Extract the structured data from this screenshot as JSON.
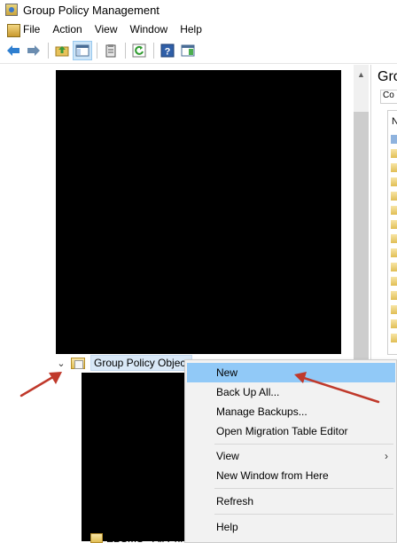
{
  "window": {
    "title": "Group Policy Management"
  },
  "menu": [
    "File",
    "Action",
    "View",
    "Window",
    "Help"
  ],
  "toolbar": {
    "icons": [
      "back-icon",
      "forward-icon",
      "up-folder-icon",
      "show-hide-tree-icon",
      "clipboard-icon",
      "refresh-icon",
      "help-icon",
      "action-pane-icon"
    ]
  },
  "tree": {
    "selected_node": "Group Policy Object",
    "partial_item": "EBSMS - All Printers GPO"
  },
  "right_pane": {
    "header": "Grou",
    "tab": "Co",
    "column": "N"
  },
  "context_menu": {
    "items": [
      {
        "label": "New",
        "highlighted": true
      },
      {
        "label": "Back Up All..."
      },
      {
        "label": "Manage Backups..."
      },
      {
        "label": "Open Migration Table Editor"
      },
      {
        "label": "View",
        "submenu": true
      },
      {
        "label": "New Window from Here"
      },
      {
        "label": "Refresh"
      },
      {
        "label": "Help"
      }
    ]
  },
  "colors": {
    "highlight": "#91c9f7",
    "selection": "#d9e8f7",
    "annotation_arrow": "#c0392b"
  }
}
